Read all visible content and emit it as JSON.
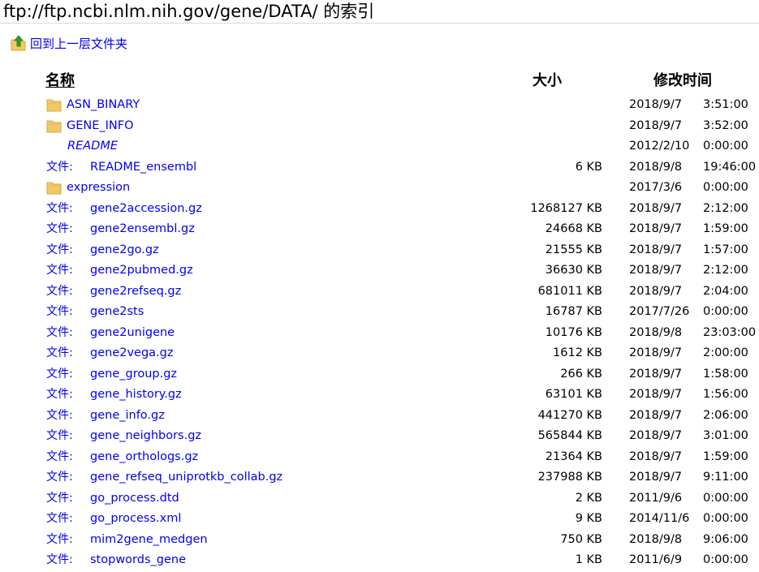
{
  "page": {
    "title": "ftp://ftp.ncbi.nlm.nih.gov/gene/DATA/ 的索引",
    "up_link": "回到上一层文件夹",
    "file_prefix": "文件:"
  },
  "headers": {
    "name": "名称",
    "size": "大小",
    "modified": "修改时间"
  },
  "entries": [
    {
      "type": "folder",
      "name": "ASN_BINARY",
      "size": "",
      "date": "2018/9/7",
      "time": "3:51:00"
    },
    {
      "type": "folder",
      "name": "GENE_INFO",
      "size": "",
      "date": "2018/9/7",
      "time": "3:52:00"
    },
    {
      "type": "link",
      "name": "README",
      "size": "",
      "date": "2012/2/10",
      "time": "0:00:00"
    },
    {
      "type": "file",
      "name": "README_ensembl",
      "size": "6 KB",
      "date": "2018/9/8",
      "time": "19:46:00"
    },
    {
      "type": "folder",
      "name": "expression",
      "size": "",
      "date": "2017/3/6",
      "time": "0:00:00"
    },
    {
      "type": "file",
      "name": "gene2accession.gz",
      "size": "1268127 KB",
      "date": "2018/9/7",
      "time": "2:12:00"
    },
    {
      "type": "file",
      "name": "gene2ensembl.gz",
      "size": "24668 KB",
      "date": "2018/9/7",
      "time": "1:59:00"
    },
    {
      "type": "file",
      "name": "gene2go.gz",
      "size": "21555 KB",
      "date": "2018/9/7",
      "time": "1:57:00"
    },
    {
      "type": "file",
      "name": "gene2pubmed.gz",
      "size": "36630 KB",
      "date": "2018/9/7",
      "time": "2:12:00"
    },
    {
      "type": "file",
      "name": "gene2refseq.gz",
      "size": "681011 KB",
      "date": "2018/9/7",
      "time": "2:04:00"
    },
    {
      "type": "file",
      "name": "gene2sts",
      "size": "16787 KB",
      "date": "2017/7/26",
      "time": "0:00:00"
    },
    {
      "type": "file",
      "name": "gene2unigene",
      "size": "10176 KB",
      "date": "2018/9/8",
      "time": "23:03:00"
    },
    {
      "type": "file",
      "name": "gene2vega.gz",
      "size": "1612 KB",
      "date": "2018/9/7",
      "time": "2:00:00"
    },
    {
      "type": "file",
      "name": "gene_group.gz",
      "size": "266 KB",
      "date": "2018/9/7",
      "time": "1:58:00"
    },
    {
      "type": "file",
      "name": "gene_history.gz",
      "size": "63101 KB",
      "date": "2018/9/7",
      "time": "1:56:00"
    },
    {
      "type": "file",
      "name": "gene_info.gz",
      "size": "441270 KB",
      "date": "2018/9/7",
      "time": "2:06:00"
    },
    {
      "type": "file",
      "name": "gene_neighbors.gz",
      "size": "565844 KB",
      "date": "2018/9/7",
      "time": "3:01:00"
    },
    {
      "type": "file",
      "name": "gene_orthologs.gz",
      "size": "21364 KB",
      "date": "2018/9/7",
      "time": "1:59:00"
    },
    {
      "type": "file",
      "name": "gene_refseq_uniprotkb_collab.gz",
      "size": "237988 KB",
      "date": "2018/9/7",
      "time": "9:11:00"
    },
    {
      "type": "file",
      "name": "go_process.dtd",
      "size": "2 KB",
      "date": "2011/9/6",
      "time": "0:00:00"
    },
    {
      "type": "file",
      "name": "go_process.xml",
      "size": "9 KB",
      "date": "2014/11/6",
      "time": "0:00:00"
    },
    {
      "type": "file",
      "name": "mim2gene_medgen",
      "size": "750 KB",
      "date": "2018/9/8",
      "time": "9:06:00"
    },
    {
      "type": "file",
      "name": "stopwords_gene",
      "size": "1 KB",
      "date": "2011/6/9",
      "time": "0:00:00"
    }
  ],
  "colors": {
    "link": "#0000ee",
    "folder": "#f2c867",
    "folder_edge": "#d9a93c",
    "up_arrow": "#2e9e2e"
  },
  "icons": {
    "folder": "folder-icon",
    "up": "up-folder-icon"
  }
}
